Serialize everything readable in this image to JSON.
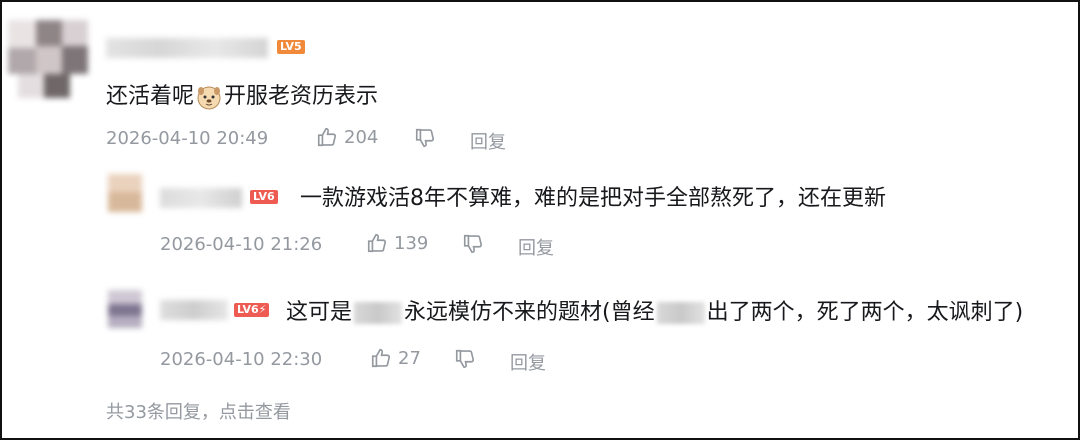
{
  "root_comment": {
    "level_badge": "LV5",
    "content_before_emoji": "还活着呢",
    "emoji": "dog-face-emoji",
    "content_after_emoji": "开服老资历表示",
    "timestamp": "2026-04-10 20:49",
    "like_count": "204",
    "reply_label": "回复"
  },
  "replies": [
    {
      "level_badge": "LV6",
      "content": "一款游戏活8年不算难，难的是把对手全部熬死了，还在更新",
      "timestamp": "2026-04-10 21:26",
      "like_count": "139",
      "reply_label": "回复"
    },
    {
      "level_badge": "LV6⚡",
      "content_part1": "这可是",
      "content_part2": "永远模仿不来的题材(曾经",
      "content_part3": "出了两个，死了两个，太讽刺了)",
      "timestamp": "2026-04-10 22:30",
      "like_count": "27",
      "reply_label": "回复"
    }
  ],
  "more_replies": "共33条回复，点击查看",
  "colors": {
    "meta_gray": "#9499a0",
    "text": "#18191c",
    "lv5": "#f0893a",
    "lv6": "#ee5b52"
  }
}
